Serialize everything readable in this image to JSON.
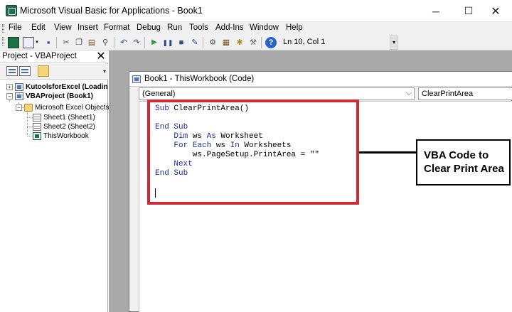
{
  "window": {
    "title": "Microsoft Visual Basic for Applications - Book1",
    "controls": {
      "minimize": "─",
      "maximize": "☐",
      "close": "✕"
    }
  },
  "menu": [
    "File",
    "Edit",
    "View",
    "Insert",
    "Format",
    "Debug",
    "Run",
    "Tools",
    "Add-Ins",
    "Window",
    "Help"
  ],
  "toolbar": {
    "cursor_position": "Ln 10, Col 1",
    "icons": [
      "view-excel-icon",
      "insert-module-icon",
      "save-icon",
      "cut-icon",
      "copy-icon",
      "paste-icon",
      "find-icon",
      "undo-icon",
      "redo-icon",
      "run-icon",
      "break-icon",
      "reset-icon",
      "design-mode-icon",
      "project-explorer-icon",
      "properties-icon",
      "object-browser-icon",
      "toolbox-icon",
      "help-icon"
    ]
  },
  "project_panel": {
    "title": "Project - VBAProject",
    "tree": [
      {
        "label": "KutoolsforExcel (Loadin",
        "bold": true,
        "toggle": "+"
      },
      {
        "label": "VBAProject (Book1)",
        "bold": true,
        "toggle": "−"
      },
      {
        "label": "Microsoft Excel Objects",
        "bold": false,
        "toggle": "−"
      },
      {
        "label": "Sheet1 (Sheet1)",
        "bold": false
      },
      {
        "label": "Sheet2 (Sheet2)",
        "bold": false
      },
      {
        "label": "ThisWorkbook",
        "bold": false
      }
    ]
  },
  "code_window": {
    "title": "Book1 - ThisWorkbook (Code)",
    "object_dropdown": "(General)",
    "procedure_dropdown": "ClearPrintArea",
    "lines": [
      [
        [
          "kw",
          "Sub"
        ],
        [
          "",
          " ClearPrintArea()"
        ]
      ],
      [],
      [
        [
          "kw",
          "End Sub"
        ]
      ],
      [
        [
          "",
          "    "
        ],
        [
          "kw",
          "Dim"
        ],
        [
          "",
          " ws "
        ],
        [
          "kw",
          "As"
        ],
        [
          "",
          " Worksheet"
        ]
      ],
      [
        [
          "",
          "    "
        ],
        [
          "kw",
          "For Each"
        ],
        [
          "",
          " ws "
        ],
        [
          "kw",
          "In"
        ],
        [
          "",
          " Worksheets"
        ]
      ],
      [
        [
          "",
          "        ws.PageSetup.PrintArea = \"\""
        ]
      ],
      [
        [
          "",
          "    "
        ],
        [
          "kw",
          "Next"
        ]
      ],
      [
        [
          "kw",
          "End Sub"
        ]
      ],
      [],
      []
    ]
  },
  "annotation": {
    "line1": "VBA Code to",
    "line2": "Clear Print Area",
    "highlight_color": "#d12a35"
  }
}
